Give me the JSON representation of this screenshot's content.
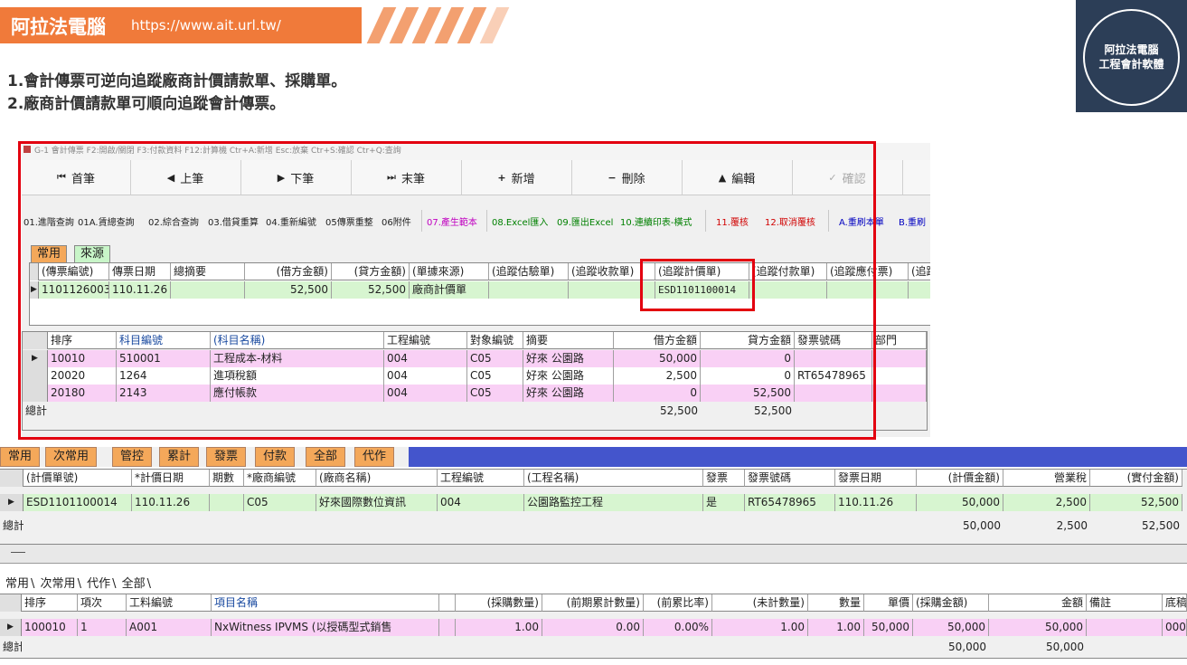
{
  "banner": {
    "title": "阿拉法電腦",
    "url": "https://www.ait.url.tw/"
  },
  "headings": [
    "1.會計傳票可逆向追蹤廠商計價請款單、採購單。",
    "2.廠商計價請款單可順向追蹤會計傳票。"
  ],
  "logo": {
    "line1": "阿拉法電腦",
    "line2": "工程會計軟體"
  },
  "window": {
    "title": "G-1 會計傳票   F2:開啟/關閉   F3:付款資料  F12:計算機  Ctr+A:新增  Esc:放棄  Ctr+S:確認  Ctr+Q:查詢",
    "toolbar": [
      {
        "icon": "⏮",
        "label": "首筆"
      },
      {
        "icon": "◀",
        "label": "上筆"
      },
      {
        "icon": "▶",
        "label": "下筆"
      },
      {
        "icon": "⏭",
        "label": "末筆"
      },
      {
        "icon": "+",
        "label": "新增"
      },
      {
        "icon": "−",
        "label": "刪除"
      },
      {
        "icon": "▲",
        "label": "編輯"
      },
      {
        "icon": "✓",
        "label": "確認"
      }
    ],
    "functions": [
      "01.進階查詢",
      "01A.賃總查詢",
      "02.綜合查詢",
      "03.借貸重算",
      "04.重新編號",
      "05傳票重整",
      "06附件",
      "07.產生範本",
      "08.Excel匯入",
      "09.匯出Excel",
      "10.連續印表-橫式",
      "11.覆核",
      "12.取消覆核",
      "A.重刷本單",
      "B.重刷"
    ],
    "tabs": [
      "常用",
      "來源"
    ],
    "voucher_headers": [
      "(傳票編號)",
      "傳票日期",
      "總摘要",
      "(借方金額)",
      "(貸方金額)",
      "(單據來源)",
      "(追蹤估驗單)",
      "(追蹤收款單)",
      "(追蹤計價單)",
      "(追蹤付款單)",
      "(追蹤應付票)",
      "(追蹤"
    ],
    "voucher_row": [
      "1101126003",
      "110.11.26",
      "",
      "52,500",
      "52,500",
      "廠商計價單",
      "",
      "",
      "ESD1101100014",
      "",
      "",
      ""
    ],
    "detail_headers": [
      "排序",
      "科目編號",
      "(科目名稱)",
      "工程編號",
      "對象編號",
      "摘要",
      "借方金額",
      "貸方金額",
      "發票號碼",
      "部門"
    ],
    "detail_rows": [
      [
        "10010",
        "510001",
        "工程成本-材料",
        "004",
        "C05",
        "好來 公園路",
        "50,000",
        "0",
        "",
        ""
      ],
      [
        "20020",
        "1264",
        "進項稅額",
        "004",
        "C05",
        "好來 公園路",
        "2,500",
        "0",
        "RT65478965",
        ""
      ],
      [
        "20180",
        "2143",
        "應付帳款",
        "004",
        "C05",
        "好來 公園路",
        "0",
        "52,500",
        "",
        ""
      ]
    ],
    "total_label": "總計",
    "totals": [
      "52,500",
      "52,500"
    ]
  },
  "lower": {
    "tabs": [
      "常用",
      "次常用",
      "管控",
      "累計",
      "發票",
      "付款",
      "全部",
      "代作"
    ],
    "headers": [
      "(計價單號)",
      "*計價日期",
      "期數",
      "*廠商編號",
      "(廠商名稱)",
      "工程編號",
      "(工程名稱)",
      "發票",
      "發票號碼",
      "發票日期",
      "(計價金額)",
      "營業稅",
      "(實付金額)"
    ],
    "row": [
      "ESD1101100014",
      "110.11.26",
      "",
      "C05",
      "好來國際數位資訊",
      "004",
      "公園路監控工程",
      "是",
      "RT65478965",
      "110.11.26",
      "50,000",
      "2,500",
      "52,500"
    ],
    "total_label": "總計",
    "totals": [
      "50,000",
      "2,500",
      "52,500"
    ],
    "sub_tabs": [
      "常用",
      "次常用",
      "代作",
      "全部"
    ],
    "item_headers": [
      "排序",
      "項次",
      "工料編號",
      "項目名稱",
      "",
      "(採購數量)",
      "(前期累計數量)",
      "(前累比率)",
      "(未計數量)",
      "數量",
      "單價",
      "(採購金額)",
      "金額",
      "備註",
      "底稿"
    ],
    "item_row": [
      "100010",
      "1",
      "A001",
      "NxWitness IPVMS (以授碼型式銷售",
      "",
      "1.00",
      "0.00",
      "0.00%",
      "1.00",
      "1.00",
      "50,000",
      "50,000",
      "50,000",
      "",
      "000"
    ],
    "item_totals": [
      "50,000",
      "50,000"
    ]
  }
}
